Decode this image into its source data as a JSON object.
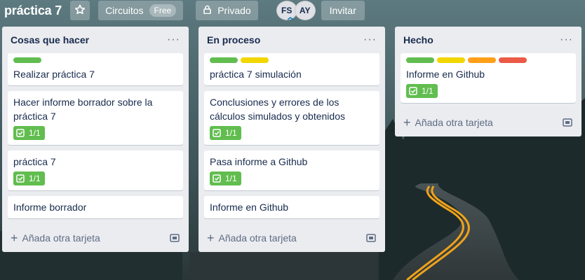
{
  "board": {
    "title": "práctica 7",
    "workspace": "Circuitos",
    "workspace_badge": "Free",
    "privacy": "Privado",
    "members": [
      "FS",
      "AY"
    ],
    "invite": "Invitar"
  },
  "label_colors": {
    "green": "#61bd4f",
    "yellow": "#f2d600",
    "orange": "#ff9f1a",
    "red": "#eb5a46"
  },
  "add_card_label": "Añada otra tarjeta",
  "lists": [
    {
      "title": "Cosas que hacer",
      "cards": [
        {
          "title": "Realizar práctica 7",
          "labels": [
            "green"
          ]
        },
        {
          "title": "Hacer informe borrador sobre la práctica 7",
          "checklist": "1/1"
        },
        {
          "title": "práctica 7",
          "checklist": "1/1"
        },
        {
          "title": "Informe borrador"
        }
      ]
    },
    {
      "title": "En proceso",
      "cards": [
        {
          "title": "práctica 7 simulación",
          "labels": [
            "green",
            "yellow"
          ]
        },
        {
          "title": "Conclusiones y errores de los cálculos simulados y obtenidos",
          "checklist": "1/1"
        },
        {
          "title": "Pasa informe a Github",
          "checklist": "1/1"
        },
        {
          "title": "Informe en Github"
        }
      ]
    },
    {
      "title": "Hecho",
      "cards": [
        {
          "title": "Informe en Github",
          "labels": [
            "green",
            "yellow",
            "orange",
            "red"
          ],
          "checklist": "1/1"
        }
      ]
    }
  ]
}
